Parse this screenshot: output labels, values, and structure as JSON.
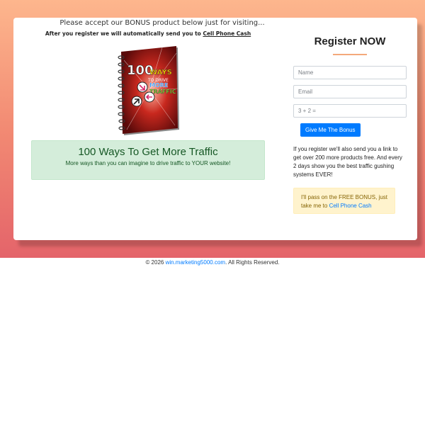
{
  "header": {
    "headline": "Please accept our BONUS product below just for visiting...",
    "subline_prefix": "After you register we will automatically send you to ",
    "subline_link": "Cell Phone Cash"
  },
  "book": {
    "cover_text_line1": "100",
    "cover_text_line2": "WAYS",
    "cover_text_line3": "TO DRIVE",
    "cover_text_line4": "MORE",
    "cover_text_line5": "TRAFFIC"
  },
  "offer": {
    "title": "100 Ways To Get More Traffic",
    "subtitle": "More ways than you can imagine to drive traffic to YOUR website!"
  },
  "register": {
    "title": "Register NOW",
    "name_placeholder": "Name",
    "email_placeholder": "Email",
    "captcha_placeholder": "3 + 2 =",
    "submit_label": "Give Me The Bonus",
    "info_text": "If you register we'll also send you a link to get over 200 more products free. And every 2 days show you the best traffic gushing systems EVER!",
    "pass_prefix": "I'll pass on the FREE BONUS, just take me to ",
    "pass_link": "Cell Phone Cash"
  },
  "footer": {
    "prefix": "© 2026 ",
    "link": "win.marketing5000.com",
    "suffix": ". All Rights Reserved."
  },
  "colors": {
    "gradient_top": "#fdb68d",
    "gradient_bottom": "#e4646a",
    "button_blue": "#007bff",
    "success_bg": "#d4edda",
    "warning_bg": "#fff3cd"
  }
}
